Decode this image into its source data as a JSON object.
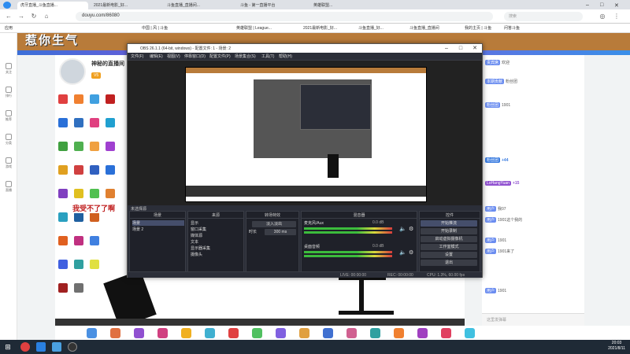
{
  "browser": {
    "tabs": [
      "虎牙直播_斗鱼直播...",
      "2021最新电影_好...",
      "斗鱼直播_直播间...",
      "斗鱼 - 第一直播平台",
      "英雄联盟..."
    ],
    "url": "douyu.com/86080",
    "bookmarks": [
      "应用",
      "中国 | 风 | 斗鱼",
      "英雄联盟 | League...",
      "2021最新电影_好...",
      "斗鱼直播_好...",
      "斗鱼直播_直播间",
      "我的主页 | 斗鱼",
      "问答斗鱼"
    ],
    "search_placeholder": "搜索"
  },
  "left_nav": [
    "关注",
    "排行",
    "推荐",
    "分类",
    "游戏",
    "直播"
  ],
  "banner_text": "惹你生气",
  "streamer": {
    "name": "神秘的直播间",
    "badge": "V5"
  },
  "obs": {
    "title": "OBS 26.1.1 (64-bit, windows) - 配置文件: 1 - 场景: 2",
    "menu": [
      "文件(F)",
      "编辑(E)",
      "视图(V)",
      "停靠窗口(D)",
      "配置文件(P)",
      "场景集合(S)",
      "工具(T)",
      "帮助(H)"
    ],
    "scene_label": "未选择源",
    "sections": {
      "scenes": {
        "title": "场景",
        "items": [
          "场景",
          "场景 2"
        ]
      },
      "sources": {
        "title": "来源",
        "items": [
          "显示",
          "窗口采集",
          "媒体源",
          "文本",
          "显示器采集",
          "摄像头"
        ]
      },
      "transitions": {
        "title": "转场特效",
        "type": "淡入淡出",
        "duration_label": "时长",
        "duration": "300 ms"
      },
      "mixer": {
        "title": "混音器",
        "tracks": [
          "麦克风/Aux",
          "桌面音频"
        ],
        "level_left": "0.0 dB",
        "level_right": "0.0 dB"
      },
      "controls": {
        "title": "控件",
        "buttons": [
          "开始推流",
          "开始录制",
          "启动虚拟摄像机",
          "工作室模式",
          "设置",
          "退出"
        ]
      }
    },
    "status": {
      "live": "LIVE: 00:00:00",
      "rec": "REC: 00:00:00",
      "cpu": "CPU: 1.3%, 60.00 fps"
    }
  },
  "chat": [
    {
      "user": "贵宾席",
      "text": "欢迎"
    },
    {
      "user": "本期贡献",
      "text": "粉丝团"
    },
    {
      "user": "粉丝团",
      "text": "1901"
    },
    {
      "user": "粉丝团",
      "text": "+44"
    },
    {
      "user": "LoHangYuan",
      "text": "+15"
    },
    {
      "user": "用户",
      "text": "我07"
    },
    {
      "user": "用户",
      "text": "1901这个我的"
    },
    {
      "user": "用户",
      "text": "1901"
    },
    {
      "user": "用户",
      "text": "1901来了"
    },
    {
      "user": "用户",
      "text": "1901"
    }
  ],
  "chat_input_placeholder": "这里发弹幕",
  "overlay_text": "我受不了了啊",
  "clock": {
    "time": "20:03",
    "date": "2021/8/11"
  }
}
